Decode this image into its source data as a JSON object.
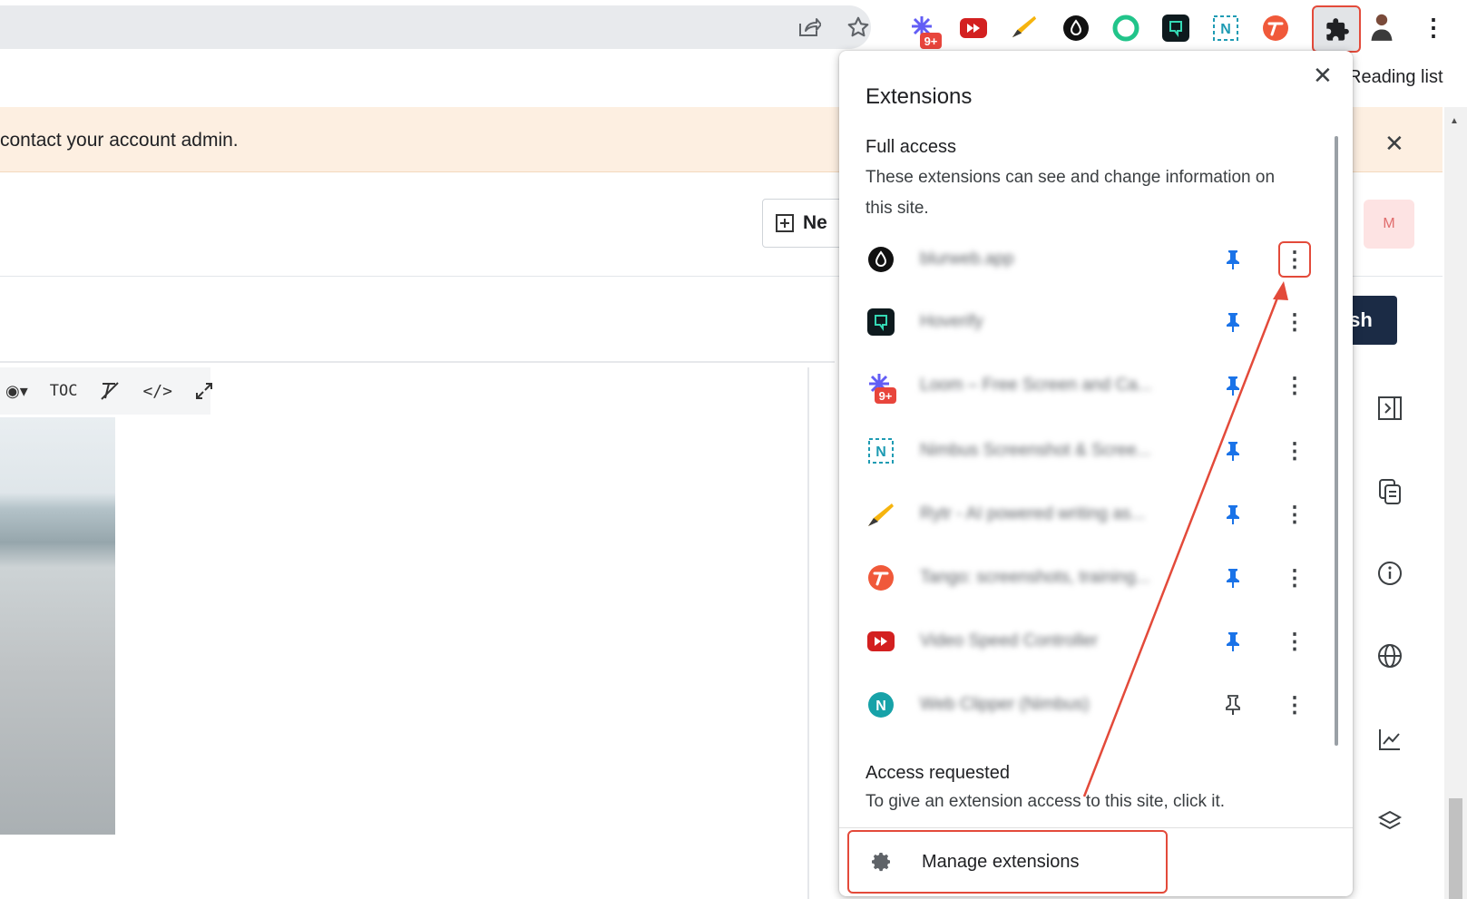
{
  "browser": {
    "toolbar": {
      "share_icon": "share-icon",
      "bookmark_icon": "star-icon",
      "extension_icons": [
        {
          "name": "loom",
          "badge": "9+"
        },
        {
          "name": "video-speed-controller"
        },
        {
          "name": "rytr"
        },
        {
          "name": "blurweb"
        },
        {
          "name": "green-ring"
        },
        {
          "name": "hoverify"
        },
        {
          "name": "nimbus"
        },
        {
          "name": "tango"
        }
      ],
      "puzzle_icon": "puzzle-icon",
      "menu_icon": "vertical-dots-icon"
    },
    "reading_list": "Reading list"
  },
  "banner": {
    "text": "contact your account admin.",
    "close": "✕"
  },
  "page": {
    "new_button": "Ne",
    "avatar_letter": "M",
    "publish_button": "sh",
    "editor_toolbar": [
      "TOC",
      "</>"
    ]
  },
  "extensions_popup": {
    "title": "Extensions",
    "close": "✕",
    "full_access": {
      "heading": "Full access",
      "description": "These extensions can see and change information on this site.",
      "items": [
        {
          "name": "blurweb.app",
          "icon": "blurweb",
          "pinned": true,
          "highlighted": true
        },
        {
          "name": "Hoverify",
          "icon": "hoverify",
          "pinned": true
        },
        {
          "name": "Loom – Free Screen and Ca...",
          "icon": "loom",
          "badge": "9+",
          "pinned": true
        },
        {
          "name": "Nimbus Screenshot & Scree...",
          "icon": "nimbus",
          "pinned": true
        },
        {
          "name": "Rytr - AI powered writing as...",
          "icon": "rytr",
          "pinned": true
        },
        {
          "name": "Tango: screenshots, training...",
          "icon": "tango",
          "pinned": true
        },
        {
          "name": "Video Speed Controller",
          "icon": "video-speed-controller",
          "pinned": true
        },
        {
          "name": "Web Clipper (Nimbus)",
          "icon": "web-clipper",
          "pinned": false
        }
      ]
    },
    "access_requested": {
      "heading": "Access requested",
      "description": "To give an extension access to this site, click it."
    },
    "manage": "Manage extensions"
  },
  "colors": {
    "annotation": "#e34a3a",
    "pin_active": "#1a73e8",
    "banner_bg": "#fdefe1",
    "publish_bg": "#1b2b45"
  }
}
